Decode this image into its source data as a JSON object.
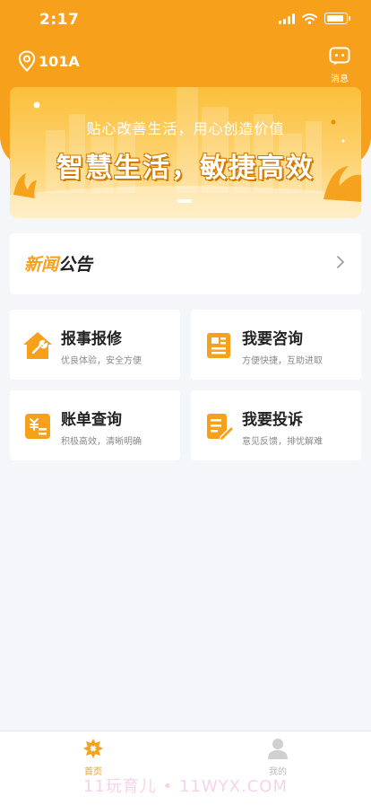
{
  "status_bar": {
    "time": "2:17"
  },
  "header": {
    "location": "101A",
    "message_label": "消息"
  },
  "banner": {
    "subtitle": "贴心改善生活，用心创造价值",
    "title": "智慧生活，敏捷高效"
  },
  "news": {
    "title_part1": "新闻",
    "title_part2": "公告"
  },
  "services": [
    {
      "title": "报事报修",
      "desc": "优良体验，安全方便",
      "icon": "repair-house-icon"
    },
    {
      "title": "我要咨询",
      "desc": "方便快捷，互助进取",
      "icon": "consult-icon"
    },
    {
      "title": "账单查询",
      "desc": "积极高效，清晰明确",
      "icon": "bill-icon"
    },
    {
      "title": "我要投诉",
      "desc": "意见反馈，排忧解难",
      "icon": "complaint-icon"
    }
  ],
  "tabbar": [
    {
      "label": "首页",
      "active": true
    },
    {
      "label": "我的",
      "active": false
    }
  ],
  "watermark": "11玩育儿 • 11WYX.COM",
  "colors": {
    "accent": "#f7a01b",
    "background": "#f4f6f9"
  }
}
